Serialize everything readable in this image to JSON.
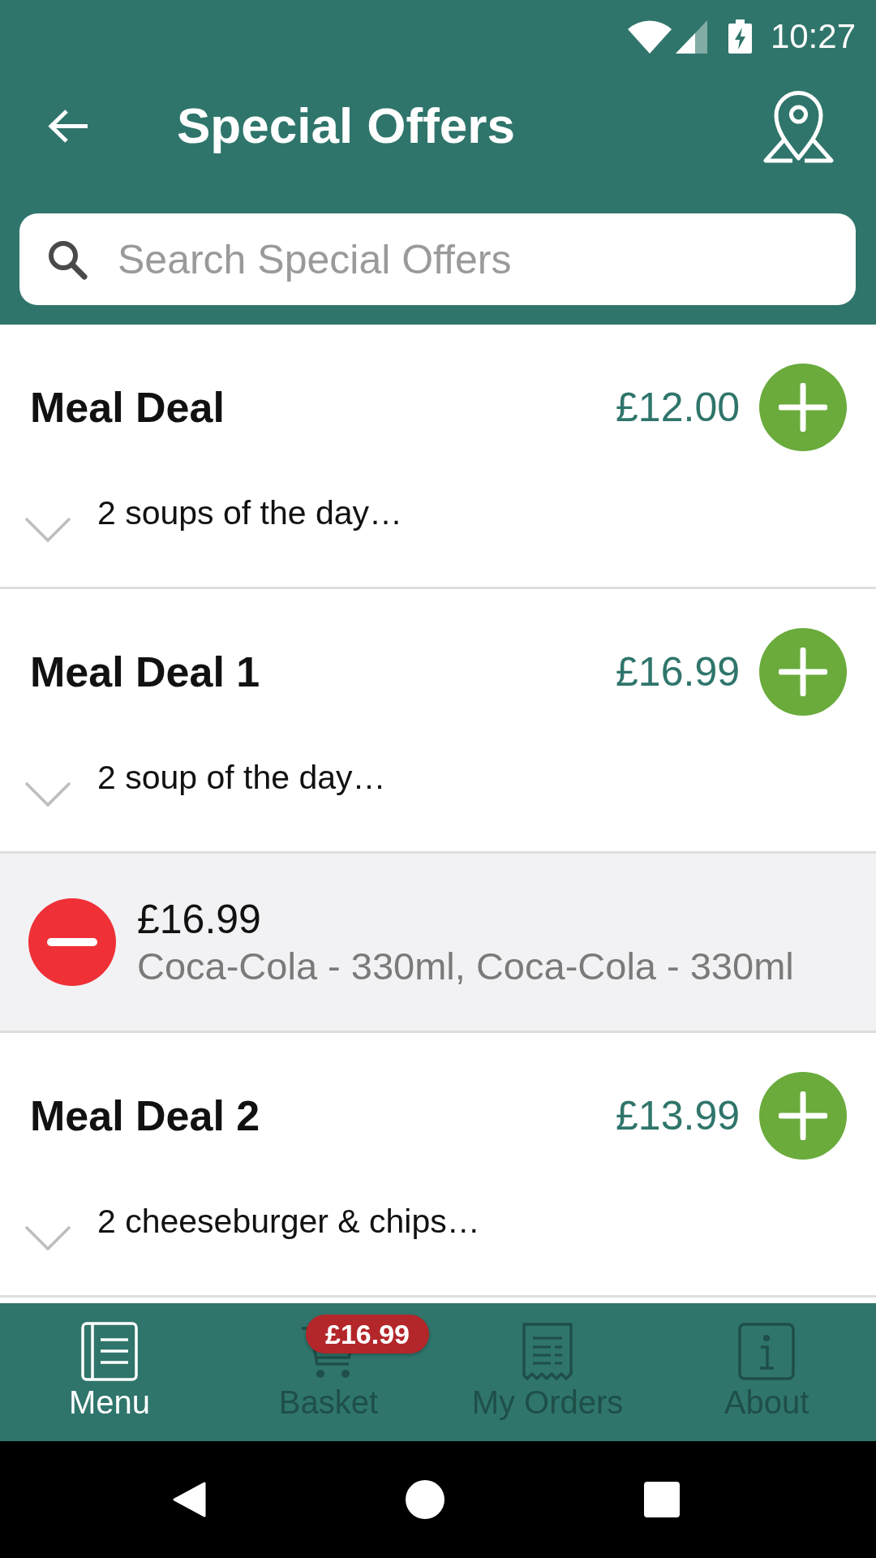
{
  "status_bar": {
    "time": "10:27"
  },
  "header": {
    "title": "Special Offers"
  },
  "search": {
    "placeholder": "Search Special Offers"
  },
  "items": [
    {
      "kind": "offer",
      "name": "Meal Deal",
      "price": "£12.00",
      "summary": "2 soups of the day…",
      "expanded": false
    },
    {
      "kind": "offer",
      "name": "Meal Deal 1",
      "price": "£16.99",
      "summary": "2 soup of the day…",
      "expanded": false
    },
    {
      "kind": "basket_line",
      "price": "£16.99",
      "contents": "Coca-Cola - 330ml, Coca-Cola - 330ml"
    },
    {
      "kind": "offer",
      "name": "Meal Deal 2",
      "price": "£13.99",
      "summary": "2 cheeseburger & chips…",
      "expanded": false
    }
  ],
  "tabs": [
    {
      "label": "Menu",
      "selected": true
    },
    {
      "label": "Basket",
      "selected": false,
      "badge": "£16.99"
    },
    {
      "label": "My Orders",
      "selected": false
    },
    {
      "label": "About",
      "selected": false
    }
  ]
}
